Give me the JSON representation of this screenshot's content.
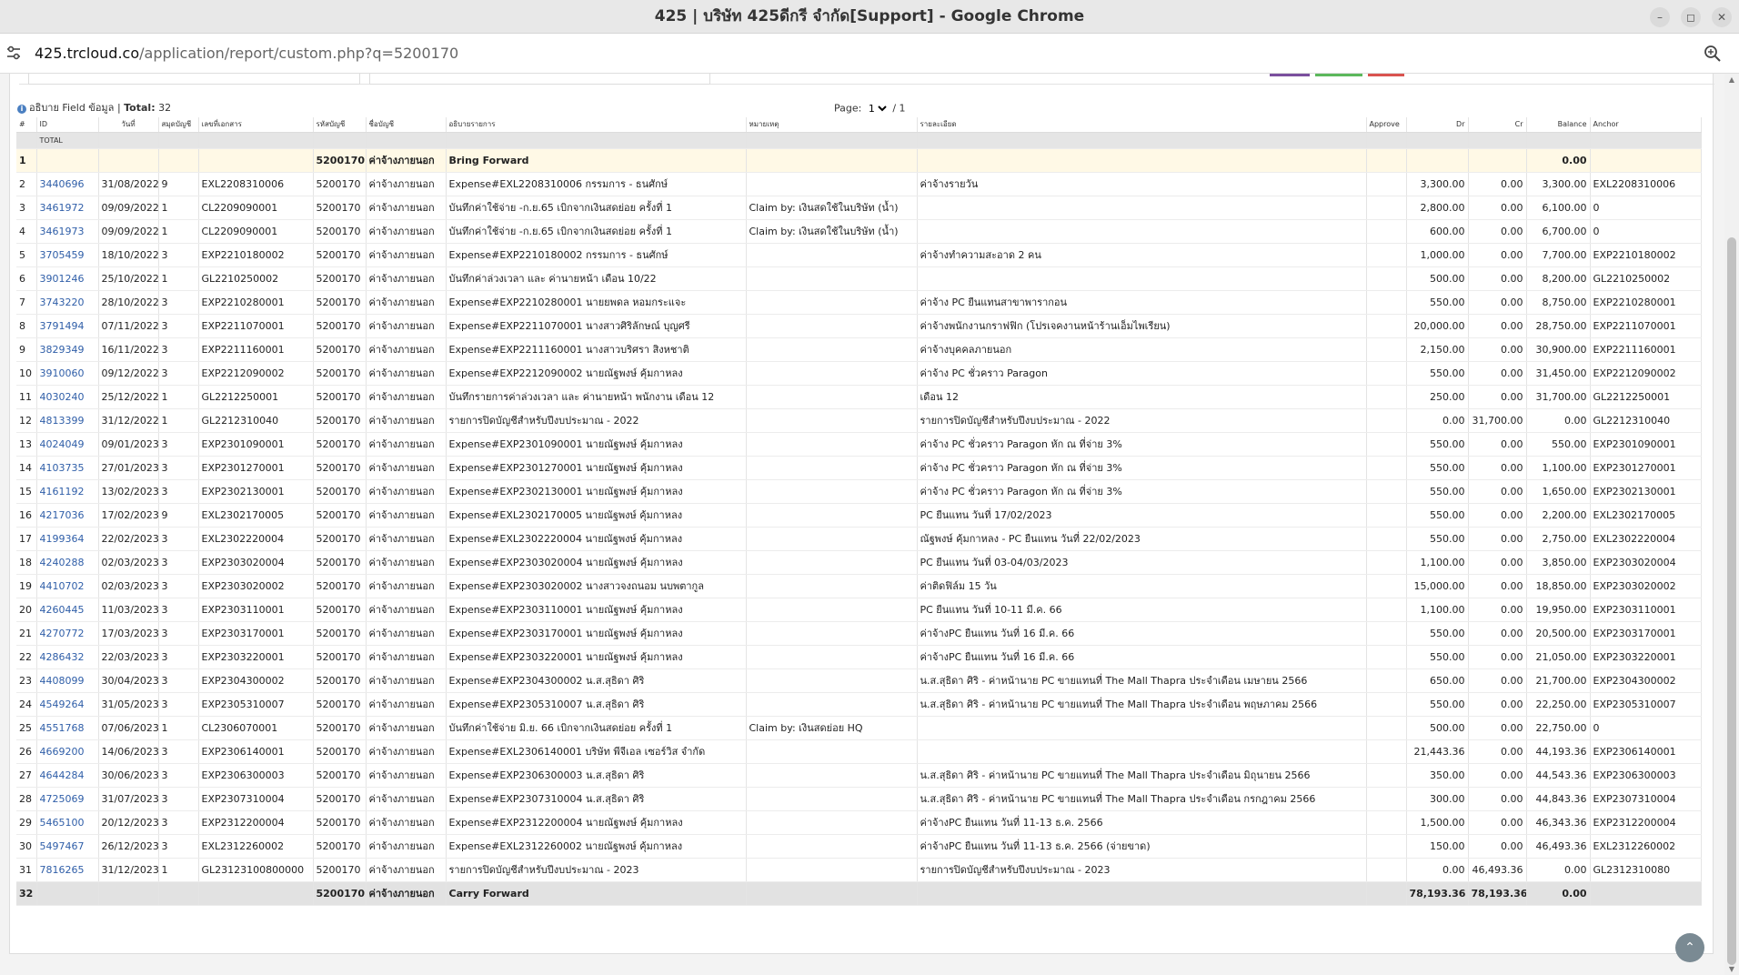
{
  "browser": {
    "window_title": "425 | บริษัท 425ดีกรี จำกัด[Support] - Google Chrome",
    "url_host": "425.trcloud.co",
    "url_path": "/application/report/custom.php?q=5200170"
  },
  "report": {
    "info_label": "อธิบาย Field ข้อมูล",
    "total_label": "Total:",
    "total_count": "32",
    "page_label": "Page:",
    "page_current": "1",
    "page_sep": "/ 1",
    "columns": [
      "#",
      "ID",
      "วันที่",
      "สมุดบัญชี",
      "เลขที่เอกสาร",
      "รหัสบัญชี",
      "ชื่อบัญชี",
      "อธิบายรายการ",
      "หมายเหตุ",
      "รายละเอียด",
      "Approve",
      "Dr",
      "Cr",
      "Balance",
      "Anchor"
    ],
    "total_row_label": "TOTAL",
    "bring_forward": {
      "no": "1",
      "account": "5200170",
      "account_name": "ค่าจ้างภายนอก",
      "desc": "Bring Forward",
      "balance": "0.00"
    },
    "rows": [
      {
        "no": "2",
        "id": "3440696",
        "date": "31/08/2022",
        "book": "9",
        "doc": "EXL2208310006",
        "account": "5200170",
        "account_name": "ค่าจ้างภายนอก",
        "desc": "Expense#EXL2208310006 กรรมการ - ธนศักษ์",
        "note": "",
        "detail": "ค่าจ้างรายวัน",
        "dr": "3,300.00",
        "cr": "0.00",
        "balance": "3,300.00",
        "anchor": "EXL2208310006"
      },
      {
        "no": "3",
        "id": "3461972",
        "date": "09/09/2022",
        "book": "1",
        "doc": "CL2209090001",
        "account": "5200170",
        "account_name": "ค่าจ้างภายนอก",
        "desc": "บันทึกค่าใช้จ่าย -ก.ย.65 เบิกจากเงินสดย่อย ครั้งที่ 1",
        "note": "Claim by: เงินสดใช้ในบริษัท (น้ำ)",
        "detail": "",
        "dr": "2,800.00",
        "cr": "0.00",
        "balance": "6,100.00",
        "anchor": "0"
      },
      {
        "no": "4",
        "id": "3461973",
        "date": "09/09/2022",
        "book": "1",
        "doc": "CL2209090001",
        "account": "5200170",
        "account_name": "ค่าจ้างภายนอก",
        "desc": "บันทึกค่าใช้จ่าย -ก.ย.65 เบิกจากเงินสดย่อย ครั้งที่ 1",
        "note": "Claim by: เงินสดใช้ในบริษัท (น้ำ)",
        "detail": "",
        "dr": "600.00",
        "cr": "0.00",
        "balance": "6,700.00",
        "anchor": "0"
      },
      {
        "no": "5",
        "id": "3705459",
        "date": "18/10/2022",
        "book": "3",
        "doc": "EXP2210180002",
        "account": "5200170",
        "account_name": "ค่าจ้างภายนอก",
        "desc": "Expense#EXP2210180002 กรรมการ - ธนศักษ์",
        "note": "",
        "detail": "ค่าจ้างทำความสะอาด 2 คน",
        "dr": "1,000.00",
        "cr": "0.00",
        "balance": "7,700.00",
        "anchor": "EXP2210180002"
      },
      {
        "no": "6",
        "id": "3901246",
        "date": "25/10/2022",
        "book": "1",
        "doc": "GL2210250002",
        "account": "5200170",
        "account_name": "ค่าจ้างภายนอก",
        "desc": "บันทึกค่าล่วงเวลา และ ค่านายหน้า เดือน 10/22",
        "note": "",
        "detail": "",
        "dr": "500.00",
        "cr": "0.00",
        "balance": "8,200.00",
        "anchor": "GL2210250002"
      },
      {
        "no": "7",
        "id": "3743220",
        "date": "28/10/2022",
        "book": "3",
        "doc": "EXP2210280001",
        "account": "5200170",
        "account_name": "ค่าจ้างภายนอก",
        "desc": "Expense#EXP2210280001 นายยพดล หอมกระแจะ",
        "note": "",
        "detail": "ค่าจ้าง PC ยืนแทนสาขาพารากอน",
        "dr": "550.00",
        "cr": "0.00",
        "balance": "8,750.00",
        "anchor": "EXP2210280001"
      },
      {
        "no": "8",
        "id": "3791494",
        "date": "07/11/2022",
        "book": "3",
        "doc": "EXP2211070001",
        "account": "5200170",
        "account_name": "ค่าจ้างภายนอก",
        "desc": "Expense#EXP2211070001 นางสาวศิริลักษณ์ บุญศรี",
        "note": "",
        "detail": "ค่าจ้างพนักงานกราฟฟิก (โปรเจคงานหน้าร้านเอ็มไพเรียน)",
        "dr": "20,000.00",
        "cr": "0.00",
        "balance": "28,750.00",
        "anchor": "EXP2211070001"
      },
      {
        "no": "9",
        "id": "3829349",
        "date": "16/11/2022",
        "book": "3",
        "doc": "EXP2211160001",
        "account": "5200170",
        "account_name": "ค่าจ้างภายนอก",
        "desc": "Expense#EXP2211160001 นางสาวบริศรา สิงหชาติ",
        "note": "",
        "detail": "ค่าจ้างบุคคลภายนอก",
        "dr": "2,150.00",
        "cr": "0.00",
        "balance": "30,900.00",
        "anchor": "EXP2211160001"
      },
      {
        "no": "10",
        "id": "3910060",
        "date": "09/12/2022",
        "book": "3",
        "doc": "EXP2212090002",
        "account": "5200170",
        "account_name": "ค่าจ้างภายนอก",
        "desc": "Expense#EXP2212090002 นายณัฐพงษ์ คุ้มกาหลง",
        "note": "",
        "detail": "ค่าจ้าง PC ชั่วคราว Paragon",
        "dr": "550.00",
        "cr": "0.00",
        "balance": "31,450.00",
        "anchor": "EXP2212090002"
      },
      {
        "no": "11",
        "id": "4030240",
        "date": "25/12/2022",
        "book": "1",
        "doc": "GL2212250001",
        "account": "5200170",
        "account_name": "ค่าจ้างภายนอก",
        "desc": "บันทึกรายการค่าล่วงเวลา และ ค่านายหน้า พนักงาน เดือน 12",
        "note": "",
        "detail": "เดือน 12",
        "dr": "250.00",
        "cr": "0.00",
        "balance": "31,700.00",
        "anchor": "GL2212250001"
      },
      {
        "no": "12",
        "id": "4813399",
        "date": "31/12/2022",
        "book": "1",
        "doc": "GL2212310040",
        "account": "5200170",
        "account_name": "ค่าจ้างภายนอก",
        "desc": "รายการปิดบัญชีสำหรับปีงบประมาณ - 2022",
        "note": "",
        "detail": "รายการปิดบัญชีสำหรับปีงบประมาณ - 2022",
        "dr": "0.00",
        "cr": "31,700.00",
        "balance": "0.00",
        "anchor": "GL2212310040"
      },
      {
        "no": "13",
        "id": "4024049",
        "date": "09/01/2023",
        "book": "3",
        "doc": "EXP2301090001",
        "account": "5200170",
        "account_name": "ค่าจ้างภายนอก",
        "desc": "Expense#EXP2301090001 นายณัฐพงษ์ คุ้มกาหลง",
        "note": "",
        "detail": "ค่าจ้าง PC ชั่วคราว Paragon หัก ณ ที่จ่าย 3%",
        "dr": "550.00",
        "cr": "0.00",
        "balance": "550.00",
        "anchor": "EXP2301090001"
      },
      {
        "no": "14",
        "id": "4103735",
        "date": "27/01/2023",
        "book": "3",
        "doc": "EXP2301270001",
        "account": "5200170",
        "account_name": "ค่าจ้างภายนอก",
        "desc": "Expense#EXP2301270001 นายณัฐพงษ์ คุ้มกาหลง",
        "note": "",
        "detail": "ค่าจ้าง PC ชั่วคราว Paragon หัก ณ ที่จ่าย 3%",
        "dr": "550.00",
        "cr": "0.00",
        "balance": "1,100.00",
        "anchor": "EXP2301270001"
      },
      {
        "no": "15",
        "id": "4161192",
        "date": "13/02/2023",
        "book": "3",
        "doc": "EXP2302130001",
        "account": "5200170",
        "account_name": "ค่าจ้างภายนอก",
        "desc": "Expense#EXP2302130001 นายณัฐพงษ์ คุ้มกาหลง",
        "note": "",
        "detail": "ค่าจ้าง PC ชั่วคราว Paragon หัก ณ ที่จ่าย 3%",
        "dr": "550.00",
        "cr": "0.00",
        "balance": "1,650.00",
        "anchor": "EXP2302130001"
      },
      {
        "no": "16",
        "id": "4217036",
        "date": "17/02/2023",
        "book": "9",
        "doc": "EXL2302170005",
        "account": "5200170",
        "account_name": "ค่าจ้างภายนอก",
        "desc": "Expense#EXL2302170005 นายณัฐพงษ์ คุ้มกาหลง",
        "note": "",
        "detail": "PC ยืนแทน วันที่ 17/02/2023",
        "dr": "550.00",
        "cr": "0.00",
        "balance": "2,200.00",
        "anchor": "EXL2302170005"
      },
      {
        "no": "17",
        "id": "4199364",
        "date": "22/02/2023",
        "book": "3",
        "doc": "EXL2302220004",
        "account": "5200170",
        "account_name": "ค่าจ้างภายนอก",
        "desc": "Expense#EXL2302220004 นายณัฐพงษ์ คุ้มกาหลง",
        "note": "",
        "detail": "ณัฐพงษ์ คุ้มกาหลง - PC ยืนแทน วันที่ 22/02/2023",
        "dr": "550.00",
        "cr": "0.00",
        "balance": "2,750.00",
        "anchor": "EXL2302220004"
      },
      {
        "no": "18",
        "id": "4240288",
        "date": "02/03/2023",
        "book": "3",
        "doc": "EXP2303020004",
        "account": "5200170",
        "account_name": "ค่าจ้างภายนอก",
        "desc": "Expense#EXP2303020004 นายณัฐพงษ์ คุ้มกาหลง",
        "note": "",
        "detail": "PC ยืนแทน วันที่ 03-04/03/2023",
        "dr": "1,100.00",
        "cr": "0.00",
        "balance": "3,850.00",
        "anchor": "EXP2303020004"
      },
      {
        "no": "19",
        "id": "4410702",
        "date": "02/03/2023",
        "book": "3",
        "doc": "EXP2303020002",
        "account": "5200170",
        "account_name": "ค่าจ้างภายนอก",
        "desc": "Expense#EXP2303020002 นางสาวจงถนอม นบพตากูล",
        "note": "",
        "detail": "ค่าติดฟิล์ม 15 วัน",
        "dr": "15,000.00",
        "cr": "0.00",
        "balance": "18,850.00",
        "anchor": "EXP2303020002"
      },
      {
        "no": "20",
        "id": "4260445",
        "date": "11/03/2023",
        "book": "3",
        "doc": "EXP2303110001",
        "account": "5200170",
        "account_name": "ค่าจ้างภายนอก",
        "desc": "Expense#EXP2303110001 นายณัฐพงษ์ คุ้มกาหลง",
        "note": "",
        "detail": "PC ยืนแทน วันที่ 10-11 มี.ค. 66",
        "dr": "1,100.00",
        "cr": "0.00",
        "balance": "19,950.00",
        "anchor": "EXP2303110001"
      },
      {
        "no": "21",
        "id": "4270772",
        "date": "17/03/2023",
        "book": "3",
        "doc": "EXP2303170001",
        "account": "5200170",
        "account_name": "ค่าจ้างภายนอก",
        "desc": "Expense#EXP2303170001 นายณัฐพงษ์ คุ้มกาหลง",
        "note": "",
        "detail": "ค่าจ้างPC ยืนแทน วันที่ 16 มี.ค. 66",
        "dr": "550.00",
        "cr": "0.00",
        "balance": "20,500.00",
        "anchor": "EXP2303170001"
      },
      {
        "no": "22",
        "id": "4286432",
        "date": "22/03/2023",
        "book": "3",
        "doc": "EXP2303220001",
        "account": "5200170",
        "account_name": "ค่าจ้างภายนอก",
        "desc": "Expense#EXP2303220001 นายณัฐพงษ์ คุ้มกาหลง",
        "note": "",
        "detail": "ค่าจ้างPC ยืนแทน วันที่ 16 มี.ค. 66",
        "dr": "550.00",
        "cr": "0.00",
        "balance": "21,050.00",
        "anchor": "EXP2303220001"
      },
      {
        "no": "23",
        "id": "4408099",
        "date": "30/04/2023",
        "book": "3",
        "doc": "EXP2304300002",
        "account": "5200170",
        "account_name": "ค่าจ้างภายนอก",
        "desc": "Expense#EXP2304300002 น.ส.สุธิดา ศิริ",
        "note": "",
        "detail": "น.ส.สุธิดา ศิริ - ค่าหน้านาย PC ขายแทนที่ The Mall Thapra ประจำเดือน เมษายน 2566",
        "dr": "650.00",
        "cr": "0.00",
        "balance": "21,700.00",
        "anchor": "EXP2304300002"
      },
      {
        "no": "24",
        "id": "4549264",
        "date": "31/05/2023",
        "book": "3",
        "doc": "EXP2305310007",
        "account": "5200170",
        "account_name": "ค่าจ้างภายนอก",
        "desc": "Expense#EXP2305310007 น.ส.สุธิดา ศิริ",
        "note": "",
        "detail": "น.ส.สุธิดา ศิริ - ค่าหน้านาย PC ขายแทนที่ The Mall Thapra ประจำเดือน พฤษภาคม 2566",
        "dr": "550.00",
        "cr": "0.00",
        "balance": "22,250.00",
        "anchor": "EXP2305310007"
      },
      {
        "no": "25",
        "id": "4551768",
        "date": "07/06/2023",
        "book": "1",
        "doc": "CL2306070001",
        "account": "5200170",
        "account_name": "ค่าจ้างภายนอก",
        "desc": "บันทึกค่าใช้จ่าย มิ.ย. 66 เบิกจากเงินสดย่อย ครั้งที่ 1",
        "note": "Claim by: เงินสดย่อย HQ",
        "detail": "",
        "dr": "500.00",
        "cr": "0.00",
        "balance": "22,750.00",
        "anchor": "0"
      },
      {
        "no": "26",
        "id": "4669200",
        "date": "14/06/2023",
        "book": "3",
        "doc": "EXP2306140001",
        "account": "5200170",
        "account_name": "ค่าจ้างภายนอก",
        "desc": "Expense#EXL2306140001 บริษัท พีจีเอล เซอร์วิส จำกัด",
        "note": "",
        "detail": "",
        "dr": "21,443.36",
        "cr": "0.00",
        "balance": "44,193.36",
        "anchor": "EXP2306140001"
      },
      {
        "no": "27",
        "id": "4644284",
        "date": "30/06/2023",
        "book": "3",
        "doc": "EXP2306300003",
        "account": "5200170",
        "account_name": "ค่าจ้างภายนอก",
        "desc": "Expense#EXP2306300003 น.ส.สุธิดา ศิริ",
        "note": "",
        "detail": "น.ส.สุธิดา ศิริ - ค่าหน้านาย PC ขายแทนที่ The Mall Thapra ประจำเดือน มิถุนายน 2566",
        "dr": "350.00",
        "cr": "0.00",
        "balance": "44,543.36",
        "anchor": "EXP2306300003"
      },
      {
        "no": "28",
        "id": "4725069",
        "date": "31/07/2023",
        "book": "3",
        "doc": "EXP2307310004",
        "account": "5200170",
        "account_name": "ค่าจ้างภายนอก",
        "desc": "Expense#EXP2307310004 น.ส.สุธิดา ศิริ",
        "note": "",
        "detail": "น.ส.สุธิดา ศิริ - ค่าหน้านาย PC ขายแทนที่ The Mall Thapra ประจำเดือน กรกฎาคม 2566",
        "dr": "300.00",
        "cr": "0.00",
        "balance": "44,843.36",
        "anchor": "EXP2307310004"
      },
      {
        "no": "29",
        "id": "5465100",
        "date": "20/12/2023",
        "book": "3",
        "doc": "EXP2312200004",
        "account": "5200170",
        "account_name": "ค่าจ้างภายนอก",
        "desc": "Expense#EXP2312200004 นายณัฐพงษ์ คุ้มกาหลง",
        "note": "",
        "detail": "ค่าจ้างPC ยืนแทน วันที่ 11-13 ธ.ค. 2566",
        "dr": "1,500.00",
        "cr": "0.00",
        "balance": "46,343.36",
        "anchor": "EXP2312200004"
      },
      {
        "no": "30",
        "id": "5497467",
        "date": "26/12/2023",
        "book": "3",
        "doc": "EXL2312260002",
        "account": "5200170",
        "account_name": "ค่าจ้างภายนอก",
        "desc": "Expense#EXL2312260002 นายณัฐพงษ์ คุ้มกาหลง",
        "note": "",
        "detail": "ค่าจ้างPC ยืนแทน วันที่ 11-13 ธ.ค. 2566 (จ่ายขาด)",
        "dr": "150.00",
        "cr": "0.00",
        "balance": "46,493.36",
        "anchor": "EXL2312260002"
      },
      {
        "no": "31",
        "id": "7816265",
        "date": "31/12/2023",
        "book": "1",
        "doc": "GL23123100800000",
        "account": "5200170",
        "account_name": "ค่าจ้างภายนอก",
        "desc": "รายการปิดบัญชีสำหรับปีงบประมาณ - 2023",
        "note": "",
        "detail": "รายการปิดบัญชีสำหรับปีงบประมาณ - 2023",
        "dr": "0.00",
        "cr": "46,493.36",
        "balance": "0.00",
        "anchor": "GL2312310080"
      }
    ],
    "carry_forward": {
      "no": "32",
      "account": "5200170",
      "account_name": "ค่าจ้างภายนอก",
      "desc": "Carry Forward",
      "dr": "78,193.36",
      "cr": "78,193.36",
      "balance": "0.00"
    }
  },
  "colors": {
    "link": "#2f5ea8",
    "bring_forward_bg": "#fff9e6",
    "carry_forward_bg": "#e2e2e2",
    "accent_purple": "#7b4f9e",
    "accent_green": "#5cb85c",
    "accent_red": "#d9534f"
  }
}
